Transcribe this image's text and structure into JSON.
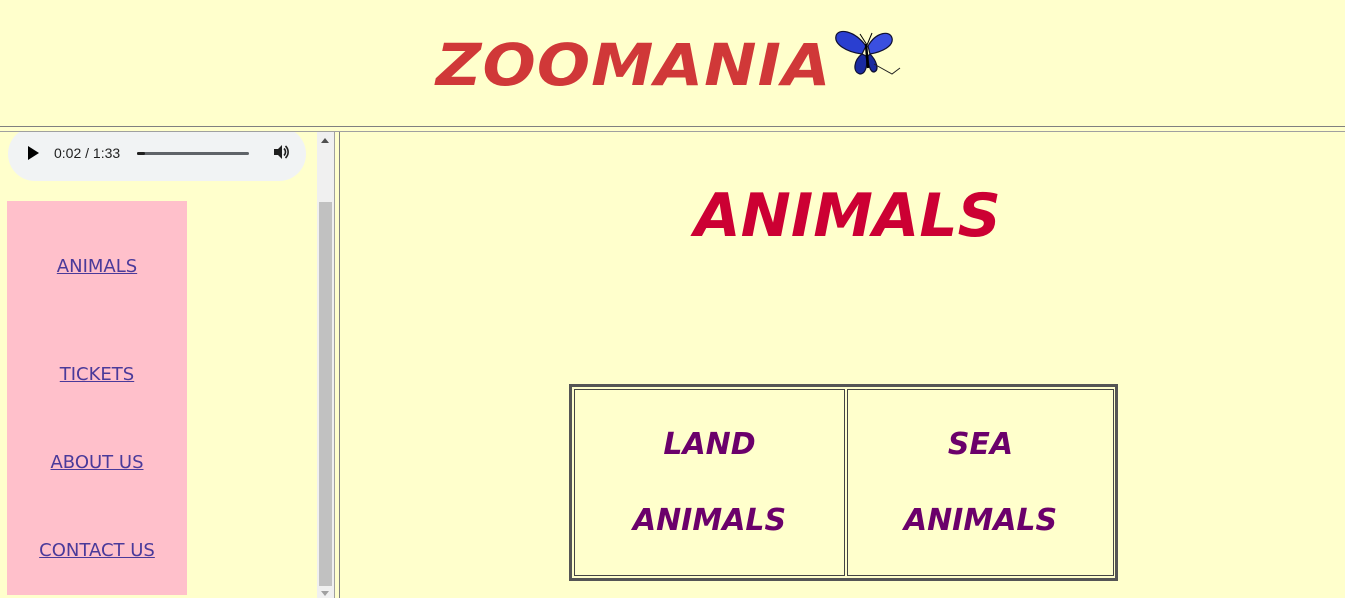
{
  "header": {
    "site_title": "ZOOMANIA",
    "logo_icon": "butterfly-icon"
  },
  "audio": {
    "time": "0:02 / 1:33",
    "progress": 0.02,
    "play_icon": "play-icon",
    "volume_icon": "volume-icon"
  },
  "nav": {
    "items": [
      {
        "label": "ANIMALS"
      },
      {
        "label": "TICKETS"
      },
      {
        "label": "ABOUT US"
      },
      {
        "label": "CONTACT US"
      }
    ]
  },
  "main": {
    "page_title": "ANIMALS",
    "categories": [
      {
        "line1": "LAND",
        "line2": "ANIMALS"
      },
      {
        "line1": "SEA",
        "line2": "ANIMALS"
      }
    ]
  },
  "colors": {
    "background": "#ffffcc",
    "nav_background": "#ffc0cb",
    "site_title": "#d03838",
    "page_title": "#cc0033",
    "category_text": "#6b006b",
    "link": "#4a3a9a"
  }
}
